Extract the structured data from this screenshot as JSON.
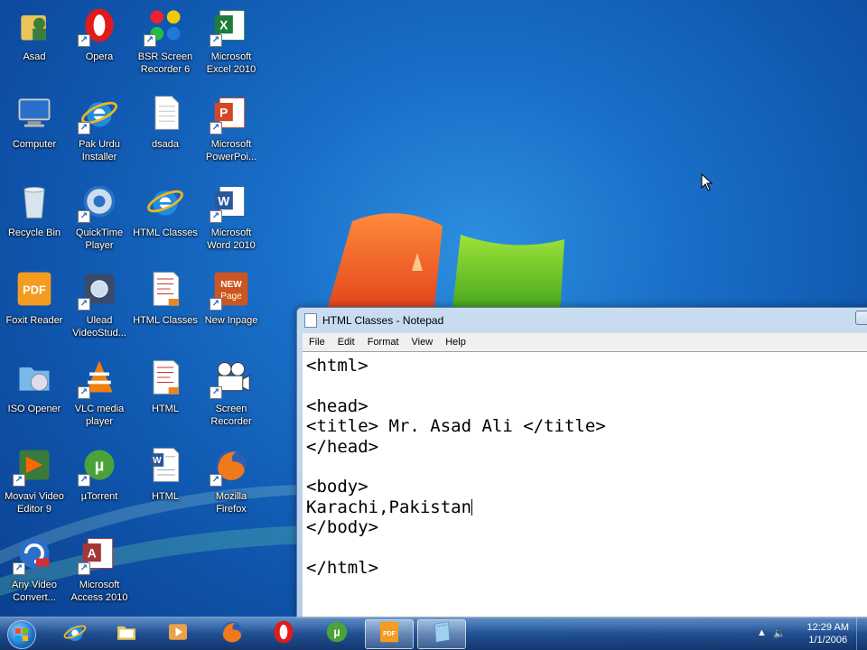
{
  "desktop": {
    "icons": [
      {
        "label": "Asad",
        "icon": "user-folder-icon"
      },
      {
        "label": "Opera",
        "icon": "opera-icon"
      },
      {
        "label": "BSR Screen\nRecorder 6",
        "icon": "bsr-icon"
      },
      {
        "label": "Microsoft\nExcel 2010",
        "icon": "excel-icon"
      },
      {
        "label": "Computer",
        "icon": "computer-icon"
      },
      {
        "label": "Pak Urdu\nInstaller",
        "icon": "ie-icon"
      },
      {
        "label": "dsada",
        "icon": "text-file-icon"
      },
      {
        "label": "Microsoft\nPowerPoi...",
        "icon": "powerpoint-icon"
      },
      {
        "label": "Recycle Bin",
        "icon": "recycle-bin-icon"
      },
      {
        "label": "QuickTime\nPlayer",
        "icon": "quicktime-icon"
      },
      {
        "label": "HTML Classes",
        "icon": "ie-icon"
      },
      {
        "label": "Microsoft\nWord 2010",
        "icon": "word-icon"
      },
      {
        "label": "Foxit Reader",
        "icon": "foxit-icon"
      },
      {
        "label": "Ulead\nVideoStud...",
        "icon": "ulead-icon"
      },
      {
        "label": "HTML Classes",
        "icon": "pdf-doc-icon"
      },
      {
        "label": "New Inpage",
        "icon": "inpage-icon"
      },
      {
        "label": "ISO Opener",
        "icon": "iso-icon"
      },
      {
        "label": "VLC media\nplayer",
        "icon": "vlc-icon"
      },
      {
        "label": "HTML",
        "icon": "pdf-doc-icon"
      },
      {
        "label": "Screen\nRecorder",
        "icon": "camera-icon"
      },
      {
        "label": "Movavi Video\nEditor 9",
        "icon": "movavi-icon"
      },
      {
        "label": "µTorrent",
        "icon": "utorrent-icon"
      },
      {
        "label": "HTML",
        "icon": "word-doc-icon"
      },
      {
        "label": "Mozilla\nFirefox",
        "icon": "firefox-icon"
      },
      {
        "label": "Any Video\nConvert...",
        "icon": "converter-icon"
      },
      {
        "label": "Microsoft\nAccess 2010",
        "icon": "access-icon"
      }
    ]
  },
  "notepad": {
    "title": "HTML Classes - Notepad",
    "menu": [
      "File",
      "Edit",
      "Format",
      "View",
      "Help"
    ],
    "lines": [
      "<html>",
      "",
      "<head>",
      "<title> Mr. Asad Ali </title>",
      "</head>",
      "",
      "<body>",
      "Karachi,Pakistan",
      "</body>",
      "",
      "</html>"
    ]
  },
  "taskbar": {
    "pinned": [
      {
        "icon": "internet-explorer-icon"
      },
      {
        "icon": "explorer-folder-icon"
      },
      {
        "icon": "media-player-icon"
      },
      {
        "icon": "firefox-icon"
      },
      {
        "icon": "opera-icon"
      },
      {
        "icon": "utorrent-icon"
      },
      {
        "icon": "foxit-reader-icon"
      },
      {
        "icon": "notepad-icon"
      }
    ],
    "clock_time": "12:29 AM",
    "clock_date": "1/1/2006"
  },
  "colors": {
    "desktop_blue": "#1a6fc8",
    "window_frame": "#b7cde6"
  }
}
